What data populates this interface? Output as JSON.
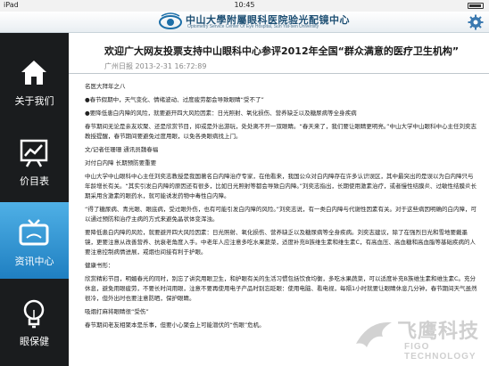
{
  "status_bar": {
    "carrier": "iPad",
    "time": "10:45"
  },
  "header": {
    "title": "中山大學附屬眼科医院验光配镜中心",
    "subtitle": "Optometry Service Center Of Eye Hospital, Sun Yat-sen University"
  },
  "sidebar": {
    "items": [
      {
        "label": "关于我们",
        "icon": "home-icon",
        "active": false
      },
      {
        "label": "价目表",
        "icon": "chart-icon",
        "active": false
      },
      {
        "label": "资讯中心",
        "icon": "tv-icon",
        "active": true
      },
      {
        "label": "眼保健",
        "icon": "bulb-icon",
        "active": false
      }
    ]
  },
  "article": {
    "title": "欢迎广大网友投票支持中山眼科中心参评2012年全国“群众满意的医疗卫生机构”",
    "meta": "广州日报 2013-2-31 16:72:89",
    "paragraphs": [
      "名医大拜年之八",
      "●春节假期中，天气变化、情绪波动、过度疲劳都会导致眼睛“受不了”",
      "●要降低患白内障的风险，就要避开四大风险因素：日光照射、氧化损伤、营养缺乏以及糖尿病等全身疾病",
      "春节期间无论是亲友欢聚、还是欣赏节目，抑或是外出游玩，处处离不开一双眼睛。“春天来了，我们要让眼睛更明亮。”中山大学中山眼科中心主任刘奕志教授提醒，春节期间要避免过度用眼，以免各类眼病找上门。",
      "文/记者任珊珊 通讯员魏春福",
      "对付白内障 长期预防要重要",
      "中山大学中山眼科中心主任刘奕志教授是我国著名白内障治疗专家，在他看来，我国公众对白内障存在许多认识误区，其中最突出的是误以为白内障只与年龄增长有关。“其实引发白内障的原因还有很多，比如日光照射等都会导致白内障。”刘奕志指出，长期使用激素治疗，或者慢性结膜炎、过敏性结膜炎长期采用含激素的眼药水，就可能诱发药物中毒性白内障。",
      "“得了糖尿病、青光眼、眼底病，受过眼外伤，也有可能引发白内障的风险。”刘奕志说，有一类白内障与代谢性因素有关。对于这些病因明确的白内障，可以通过预防和治疗主病的方式来避免晶状体变浑浊。",
      "要降低患白内障的风险，就要避开四大风险因素：日光照射、氧化损伤、营养缺乏以及糖尿病等全身疾病。刘奕志建议，除了在强烈日光和雪地要戴墨镜，更要注意从改善营养、抗衰老角度入手。中老年人应注意多吃水果蔬菜，适度补充B族维生素和维生素C，有高血压、高血糖和高血脂等基础疾病的人要注意控制病情进展，戒烟也间接有利于护眼。",
      "健康书形：",
      "欣赏精彩节目，明媚春光的同时，别忘了讲究用眼卫生，和护眼有关的生活习惯包括饮食均衡，多吃水果蔬菜，可以适度补充B族维生素和维生素C。充分休息，避免用眼疲劳，不要长时间用眼，注意不要再使用电子产品时别忘眨眼：使用电脑、看电视，每隔1小时就要让眼睛休息几分钟，春节期间天气虽然很冷，但外出时也要注意防晒，保护眼睛。",
      "吸烟打麻将眼睛很“受伤”",
      "春节期间老友相聚本是乐事，但要小心聚会上可能潜伏的“伤眼”危机。"
    ]
  },
  "watermark": {
    "text": "飞鹰科技",
    "sub": "FIGO TECHNOLOGY"
  },
  "colors": {
    "accent": "#2b8fd6",
    "sidebar_bg": "#1a1c1e",
    "header_title": "#1d4f73"
  }
}
